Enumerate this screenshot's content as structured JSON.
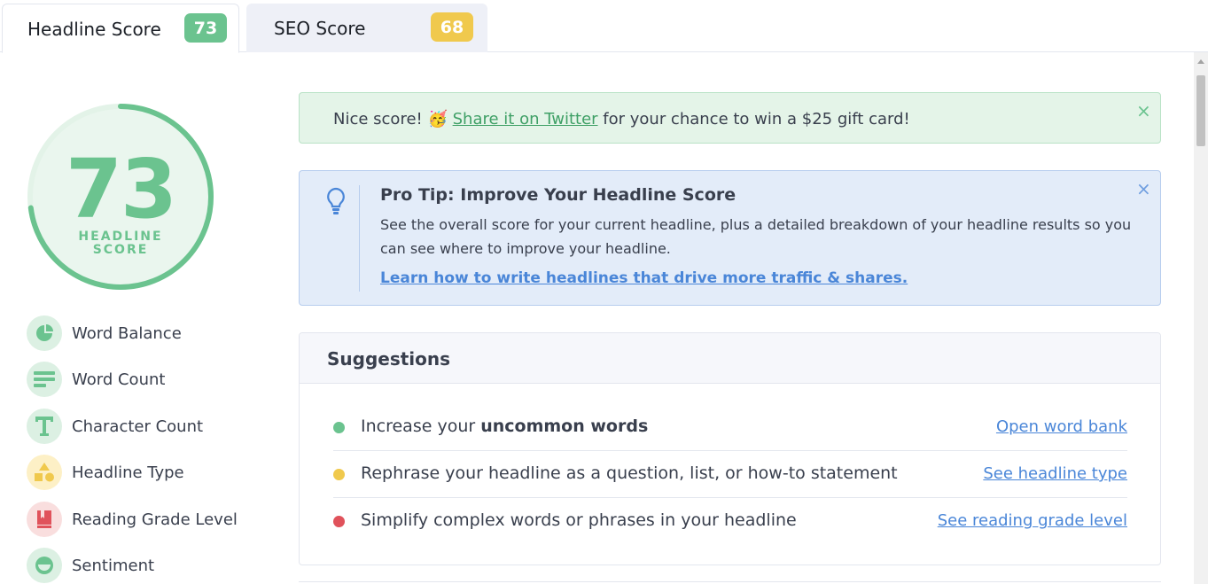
{
  "tabs": [
    {
      "label": "Headline Score",
      "score": "73",
      "active": true
    },
    {
      "label": "SEO Score",
      "score": "68",
      "active": false
    }
  ],
  "score": {
    "value": "73",
    "label_line1": "HEADLINE",
    "label_line2": "SCORE",
    "ring_fraction": 0.73,
    "color": "#6bc38f"
  },
  "nav": [
    {
      "label": "Word Balance",
      "icon": "pie-chart-icon",
      "tone": "green"
    },
    {
      "label": "Word Count",
      "icon": "lines-icon",
      "tone": "green"
    },
    {
      "label": "Character Count",
      "icon": "letter-t-icon",
      "tone": "green"
    },
    {
      "label": "Headline Type",
      "icon": "shapes-icon",
      "tone": "yellow"
    },
    {
      "label": "Reading Grade Level",
      "icon": "book-icon",
      "tone": "red"
    },
    {
      "label": "Sentiment",
      "icon": "smile-icon",
      "tone": "green"
    }
  ],
  "banner": {
    "prefix": "Nice score! ",
    "emoji": "🥳",
    "link": "Share it on Twitter",
    "suffix": " for your chance to win a $25 gift card!",
    "close": "×"
  },
  "tip": {
    "title": "Pro Tip: Improve Your Headline Score",
    "body": "See the overall score for your current headline, plus a detailed breakdown of your headline results so you can see where to improve your headline.",
    "link": "Learn how to write headlines that drive more traffic & shares.",
    "close": "×"
  },
  "suggestions": {
    "title": "Suggestions",
    "items": [
      {
        "prefix": "Increase your ",
        "bold": "uncommon words",
        "link": "Open word bank",
        "color": "#6bc38f"
      },
      {
        "prefix": "Rephrase your headline as a question, list, or how-to statement",
        "bold": "",
        "link": "See headline type",
        "color": "#f0c94d"
      },
      {
        "prefix": "Simplify complex words or phrases in your headline",
        "bold": "",
        "link": "See reading grade level",
        "color": "#e0525b"
      }
    ]
  },
  "colors": {
    "green": "#6bc38f",
    "yellow": "#f0c94d",
    "red": "#e0525b",
    "link": "#4a86d8"
  }
}
